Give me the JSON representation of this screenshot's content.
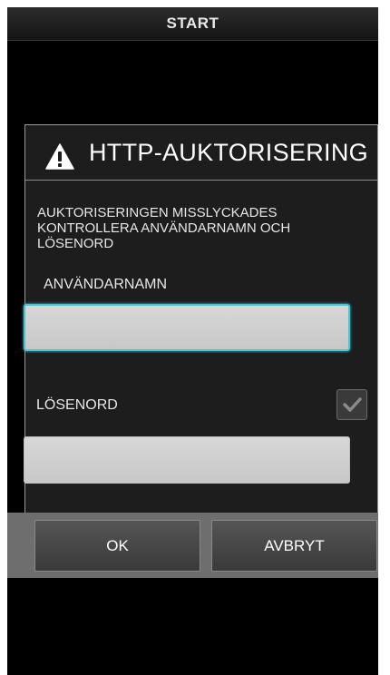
{
  "titlebar": {
    "title": "START"
  },
  "dialog": {
    "icon": "warning-icon",
    "title": "HTTP-AUKTORISERING",
    "message": "AUKTORISERINGEN MISSLYCKADES\n KONTROLLERA ANVÄNDARNAMN OCH\nLÖSENORD",
    "username_label": "ANVÄNDARNAMN",
    "username_value": "",
    "password_label": "LÖSENORD",
    "password_value": "",
    "show_password_checked": true
  },
  "buttons": {
    "ok_label": "OK",
    "cancel_label": "AVBRYT"
  },
  "colors": {
    "focus": "#49c4d2",
    "background": "#000000",
    "dialog": "#1d1d1d"
  }
}
